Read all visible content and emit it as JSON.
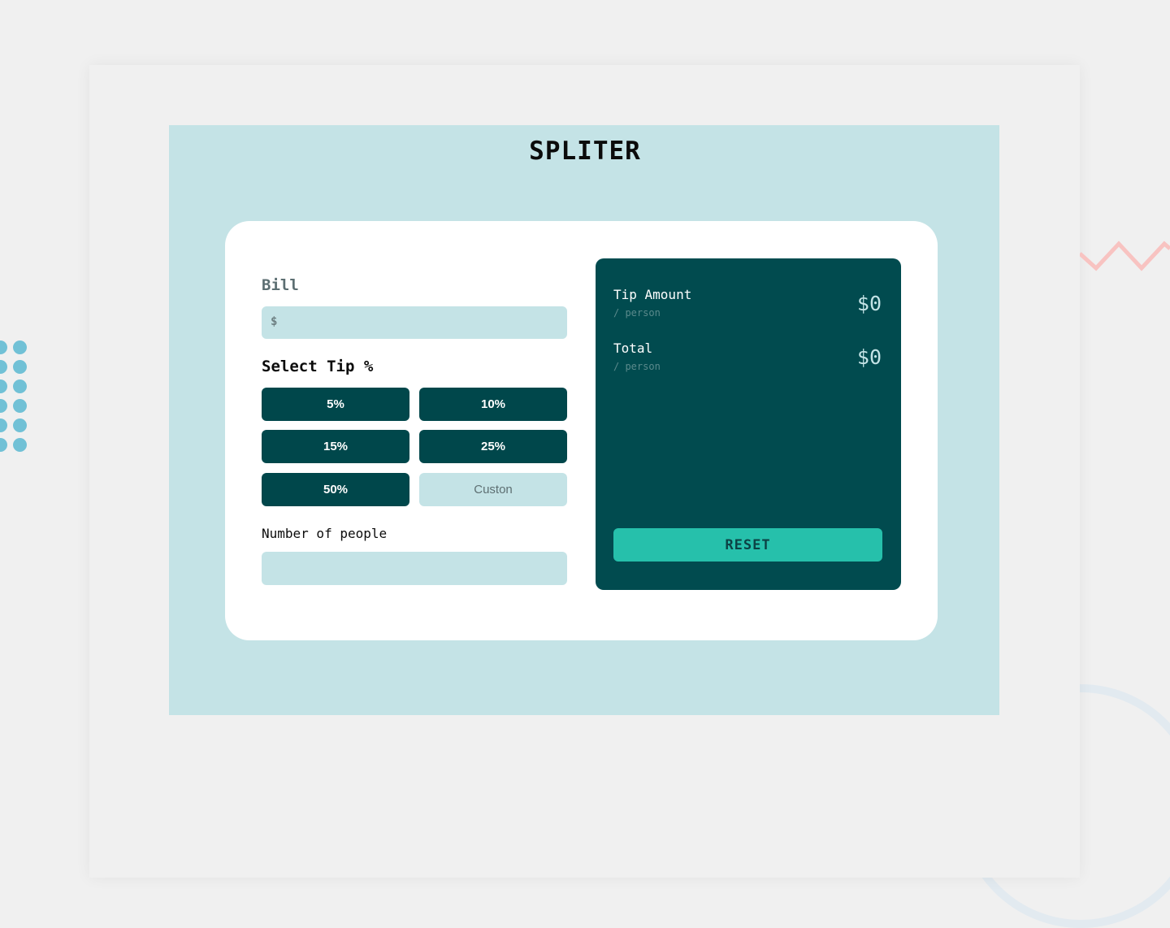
{
  "app": {
    "title": "SPLITER"
  },
  "bill": {
    "label": "Bill",
    "currency_symbol": "$",
    "value": ""
  },
  "tip": {
    "label": "Select Tip %",
    "options": [
      "5%",
      "10%",
      "15%",
      "25%",
      "50%"
    ],
    "custom_label": "Custon"
  },
  "people": {
    "label": "Number of people",
    "value": ""
  },
  "result": {
    "tip_amount": {
      "label": "Tip Amount",
      "sub": "/ person",
      "value": "$0"
    },
    "total": {
      "label": "Total",
      "sub": "/ person",
      "value": "$0"
    },
    "reset_label": "RESET"
  },
  "colors": {
    "background": "#f0f0f0",
    "app_background": "#c4e3e6",
    "dark_teal": "#00474b",
    "accent": "#26c0ab",
    "dot_decor": "#71c1d6",
    "zigzag_decor": "#f8c3c1"
  },
  "decor": {
    "dots_icon": "dot-grid-icon",
    "zigzag_icon": "zigzag-icon",
    "ring_icon": "circle-outline-icon"
  }
}
